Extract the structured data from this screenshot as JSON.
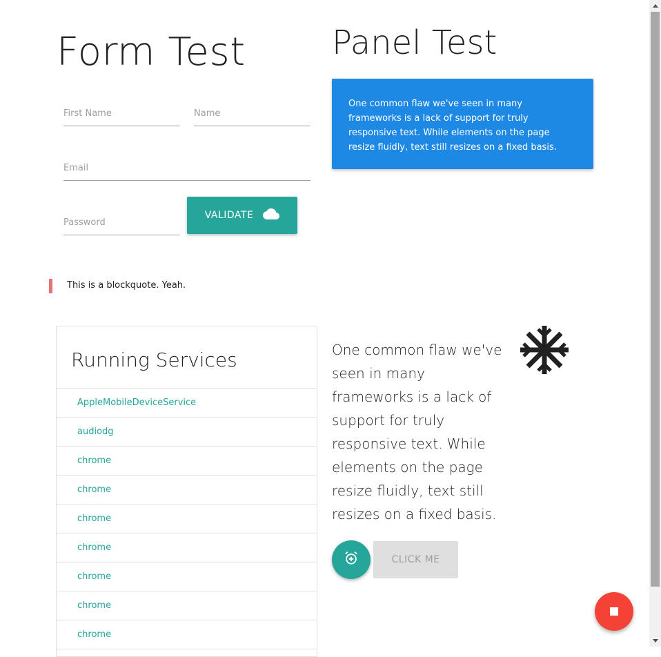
{
  "form": {
    "title": "Form Test",
    "first_name_placeholder": "First Name",
    "name_placeholder": "Name",
    "email_placeholder": "Email",
    "password_placeholder": "Password",
    "validate_label": "VALIDATE"
  },
  "panel": {
    "title": "Panel Test",
    "text": "One common flaw we've seen in many frameworks is a lack of support for truly responsive text. While elements on the page resize fluidly, text still resizes on a fixed basis."
  },
  "blockquote": {
    "text": "This is a blockquote. Yeah."
  },
  "services": {
    "title": "Running Services",
    "items": [
      "AppleMobileDeviceService",
      "audiodg",
      "chrome",
      "chrome",
      "chrome",
      "chrome",
      "chrome",
      "chrome",
      "chrome"
    ]
  },
  "flow_text": "One common flaw we've seen in many frameworks is a lack of support for truly responsive text. While elements on the page resize fluidly, text still resizes on a fixed basis.",
  "buttons": {
    "click_me_label": "CLICK ME"
  },
  "icons": {
    "validate": "cloud-icon",
    "snowflake": "snowflake-icon",
    "alarm": "alarm-add-icon",
    "stop": "stop-icon"
  },
  "colors": {
    "teal": "#26a69a",
    "blue_panel": "#1e88e5",
    "red_fab": "#f44336",
    "blockquote_bar": "#e57373",
    "disabled": "#dfdfdf"
  }
}
